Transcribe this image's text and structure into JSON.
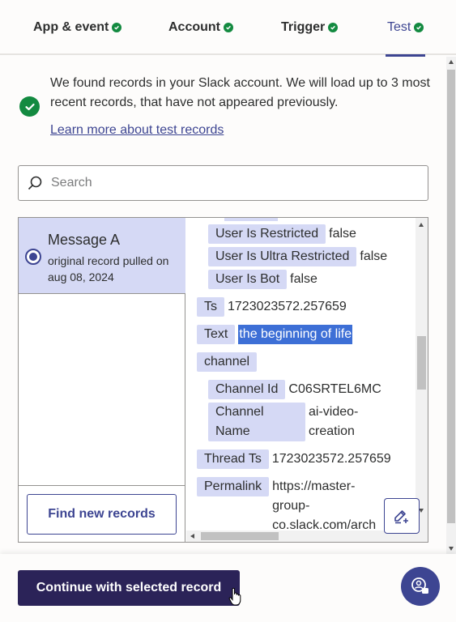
{
  "tabs": [
    {
      "label": "App & event"
    },
    {
      "label": "Account"
    },
    {
      "label": "Trigger"
    },
    {
      "label": "Test",
      "active": true
    }
  ],
  "info": {
    "text": "We found records in your Slack account. We will load up to 3 most recent records, that have not appeared previously.",
    "link": "Learn more about test records"
  },
  "search": {
    "placeholder": "Search",
    "value": ""
  },
  "record": {
    "title": "Message A",
    "subtitle": "original record pulled on aug 08, 2024"
  },
  "find_button": "Find new records",
  "fields": {
    "user_is_restricted": {
      "key": "User Is Restricted",
      "value": "false"
    },
    "user_is_ultra_restricted": {
      "key": "User Is Ultra Restricted",
      "value": "false"
    },
    "user_is_bot": {
      "key": "User Is Bot",
      "value": "false"
    },
    "ts": {
      "key": "Ts",
      "value": "1723023572.257659"
    },
    "text": {
      "key": "Text",
      "value": "the beginning of life"
    },
    "channel": {
      "key": "channel"
    },
    "channel_id": {
      "key": "Channel Id",
      "value": "C06SRTEL6MC"
    },
    "channel_name": {
      "key_line1": "Channel",
      "key_line2": "Name",
      "value_line1": "ai-video-",
      "value_line2": "creation"
    },
    "thread_ts": {
      "key": "Thread Ts",
      "value": "1723023572.257659"
    },
    "permalink": {
      "key": "Permalink",
      "value_line1": "https://master-",
      "value_line2": "group-",
      "value_line3": "co.slack.com/arch"
    }
  },
  "continue_button": "Continue with selected record",
  "colors": {
    "accent": "#3d4592",
    "success": "#138a40",
    "primary_button": "#2b2358",
    "key_bg": "#d5d9f5",
    "selection": "#3d6fd6"
  }
}
